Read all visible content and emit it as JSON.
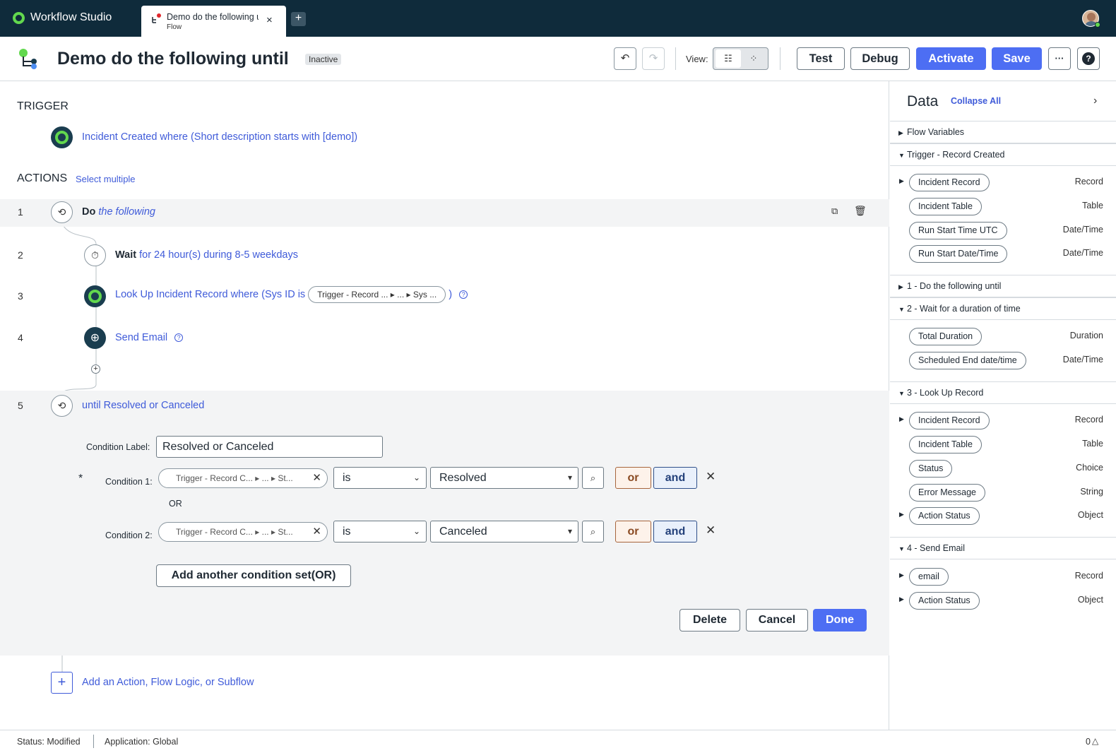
{
  "app": {
    "name": "Workflow Studio"
  },
  "tab": {
    "title": "Demo do the following until",
    "subtitle": "Flow",
    "close": "×",
    "new": "+"
  },
  "header": {
    "title": "Demo do the following until",
    "status_badge": "Inactive",
    "view_label": "View:",
    "buttons": {
      "test": "Test",
      "debug": "Debug",
      "activate": "Activate",
      "save": "Save",
      "more": "···",
      "help": "?"
    }
  },
  "trigger": {
    "heading": "TRIGGER",
    "text": "Incident Created where (Short description starts with [demo])"
  },
  "actions": {
    "heading": "ACTIONS",
    "select_multiple": "Select multiple",
    "rows": [
      {
        "num": "1",
        "keyword": "Do",
        "detail": "the following"
      },
      {
        "num": "2",
        "keyword": "Wait",
        "detail": "for 24 hour(s) during 8-5 weekdays"
      },
      {
        "num": "3",
        "text_before": "Look Up Incident Record where (Sys ID is",
        "pill": "Trigger - Record ...",
        "pill_mid": "...",
        "pill_end": "Sys ...",
        "text_after": ")"
      },
      {
        "num": "4",
        "text": "Send Email"
      },
      {
        "num": "5",
        "prefix": "until",
        "text": "Resolved or Canceled"
      }
    ],
    "add_label": "Add an Action, Flow Logic, or Subflow"
  },
  "condition_editor": {
    "label_caption": "Condition Label:",
    "label_value": "Resolved or Canceled",
    "required_mark": "*",
    "or_separator": "OR",
    "conditions": [
      {
        "caption": "Condition 1:",
        "field": "Trigger - Record C...",
        "field_mid": "...",
        "field_end": "St...",
        "operator": "is",
        "value": "Resolved"
      },
      {
        "caption": "Condition 2:",
        "field": "Trigger - Record C...",
        "field_mid": "...",
        "field_end": "St...",
        "operator": "is",
        "value": "Canceled"
      }
    ],
    "or_label": "or",
    "and_label": "and",
    "add_set": "Add another condition set(OR)",
    "buttons": {
      "delete": "Delete",
      "cancel": "Cancel",
      "done": "Done"
    }
  },
  "data_panel": {
    "title": "Data",
    "collapse_all": "Collapse All",
    "groups": {
      "flow_variables": "Flow Variables",
      "trigger": "Trigger - Record Created",
      "step1": "1 - Do the following until",
      "step2": "2 - Wait for a duration of time",
      "step3": "3 - Look Up Record",
      "step4": "4 - Send Email"
    },
    "trigger_items": [
      {
        "name": "Incident Record",
        "type": "Record"
      },
      {
        "name": "Incident Table",
        "type": "Table"
      },
      {
        "name": "Run Start Time UTC",
        "type": "Date/Time"
      },
      {
        "name": "Run Start Date/Time",
        "type": "Date/Time"
      }
    ],
    "step2_items": [
      {
        "name": "Total Duration",
        "type": "Duration"
      },
      {
        "name": "Scheduled End date/time",
        "type": "Date/Time"
      }
    ],
    "step3_items": [
      {
        "name": "Incident Record",
        "type": "Record"
      },
      {
        "name": "Incident Table",
        "type": "Table"
      },
      {
        "name": "Status",
        "type": "Choice"
      },
      {
        "name": "Error Message",
        "type": "String"
      },
      {
        "name": "Action Status",
        "type": "Object"
      }
    ],
    "step4_items": [
      {
        "name": "email",
        "type": "Record"
      },
      {
        "name": "Action Status",
        "type": "Object"
      }
    ]
  },
  "statusbar": {
    "status": "Status: Modified",
    "application": "Application: Global",
    "count": "0"
  },
  "colors": {
    "topbar": "#0f2b3b",
    "primary": "#4d6ef3",
    "link": "#3f5bd9",
    "brand_green": "#62d84e"
  },
  "icons": [
    "workflow-logo-icon",
    "flow-tab-icon",
    "undo-icon",
    "redo-icon",
    "tree-view-icon",
    "grid-view-icon",
    "help-icon",
    "loop-icon",
    "timer-icon",
    "globe-icon",
    "plus-icon",
    "trash-icon",
    "view-details-icon",
    "pill-picker-icon",
    "chevron-right-icon",
    "warning-icon"
  ]
}
